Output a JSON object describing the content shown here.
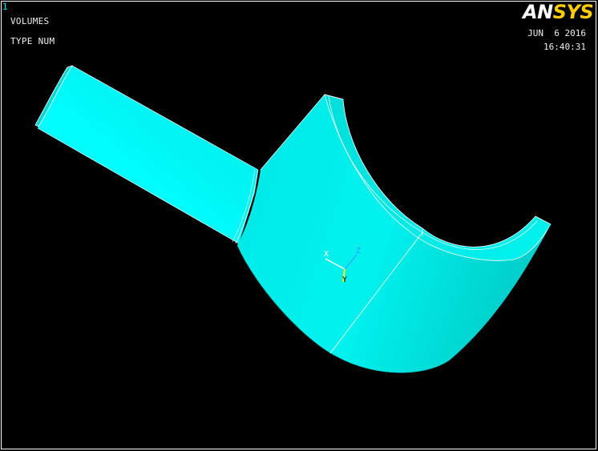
{
  "graphics_window": {
    "window_number": "1",
    "plot_title": "VOLUMES",
    "numbering": "TYPE NUM",
    "logo": {
      "prefix": "AN",
      "suffix": "SYS"
    },
    "date": "JUN  6 2016",
    "time": "16:40:31",
    "triad": {
      "x_label": "X",
      "y_label": "Y",
      "z_label": "Z"
    }
  },
  "colors": {
    "background": "#000000",
    "volume_fill": "#00f0ec",
    "edge_lines": "#ffffff",
    "logo_accent": "#ffcc00",
    "window_number": "#00e5ff"
  }
}
